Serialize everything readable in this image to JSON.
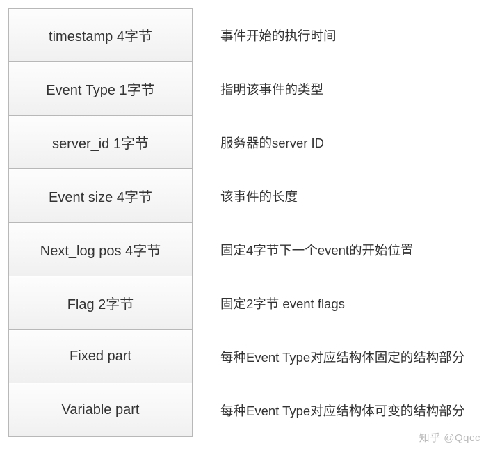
{
  "rows": [
    {
      "field": "timestamp 4字节",
      "desc": "事件开始的执行时间"
    },
    {
      "field": "Event Type 1字节",
      "desc": "指明该事件的类型"
    },
    {
      "field": "server_id 1字节",
      "desc": "服务器的server ID"
    },
    {
      "field": "Event size  4字节",
      "desc": "该事件的长度"
    },
    {
      "field": "Next_log pos 4字节",
      "desc": "固定4字节下一个event的开始位置"
    },
    {
      "field": "Flag 2字节",
      "desc": "固定2字节 event flags"
    },
    {
      "field": "Fixed part",
      "desc": "每种Event Type对应结构体固定的结构部分"
    },
    {
      "field": "Variable part",
      "desc": "每种Event Type对应结构体可变的结构部分"
    }
  ],
  "watermark": "知乎 @Qqcc"
}
